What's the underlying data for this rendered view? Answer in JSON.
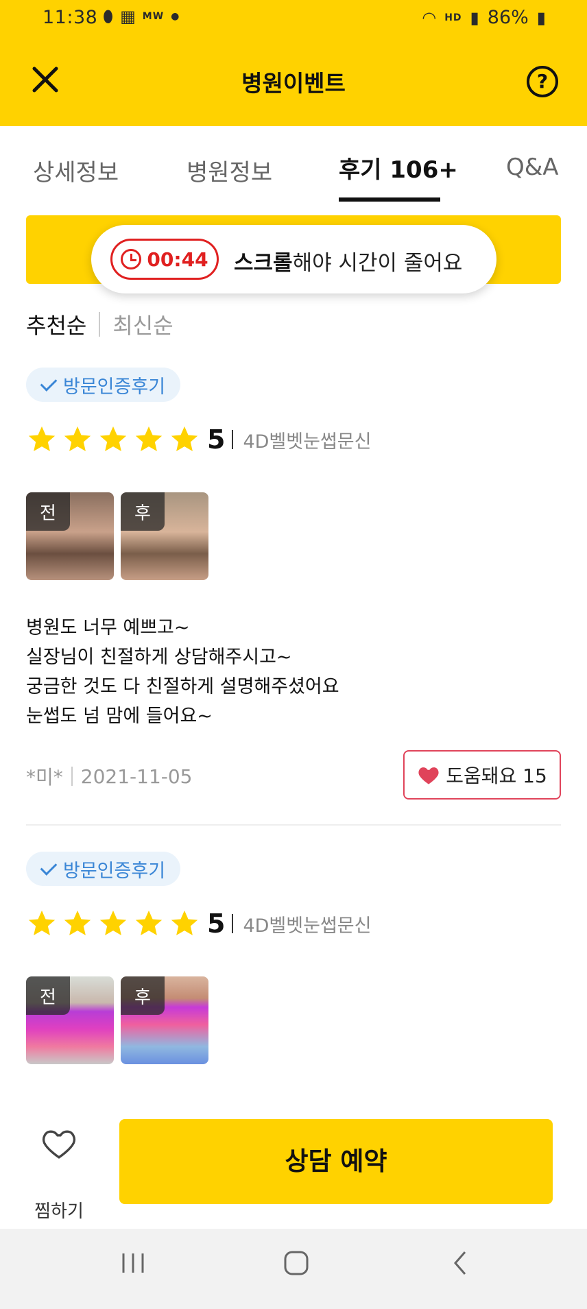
{
  "status_bar": {
    "time": "11:38",
    "left_label": "MW",
    "voice_badge": "HD",
    "battery": "86%"
  },
  "header": {
    "title": "병원이벤트",
    "help_glyph": "?"
  },
  "tabs": [
    {
      "label": "상세정보",
      "active": false
    },
    {
      "label": "병원정보",
      "active": false
    },
    {
      "label": "후기 106+",
      "active": true
    },
    {
      "label": "Q&A",
      "active": false
    }
  ],
  "timer": {
    "time": "00:44",
    "message_bold": "스크롤",
    "message_rest": "해야 시간이 줄어요"
  },
  "sort": {
    "options": [
      "추천순",
      "최신순"
    ],
    "selected": "추천순"
  },
  "reviews": [
    {
      "badge": "방문인증후기",
      "rating": "5",
      "stars": 5,
      "treatment": "4D벨벳눈썹문신",
      "photo_tags": [
        "전",
        "후"
      ],
      "text_lines": [
        "병원도 너무 예쁘고~",
        "실장님이 친절하게 상담해주시고~",
        "궁금한 것도 다 친절하게 설명해주셨어요",
        "눈썹도 넘 맘에 들어요~"
      ],
      "author": "*미*",
      "date": "2021-11-05",
      "helpful_label": "도움돼요 15"
    },
    {
      "badge": "방문인증후기",
      "rating": "5",
      "stars": 5,
      "treatment": "4D벨벳눈썹문신",
      "photo_tags": [
        "전",
        "후"
      ]
    }
  ],
  "bottom_bar": {
    "like_label": "찜하기",
    "cta_label": "상담 예약"
  },
  "colors": {
    "brand_yellow": "#FFD200",
    "timer_red": "#e02020",
    "badge_blue": "#3a86d6",
    "heart_red": "#e0435a"
  }
}
